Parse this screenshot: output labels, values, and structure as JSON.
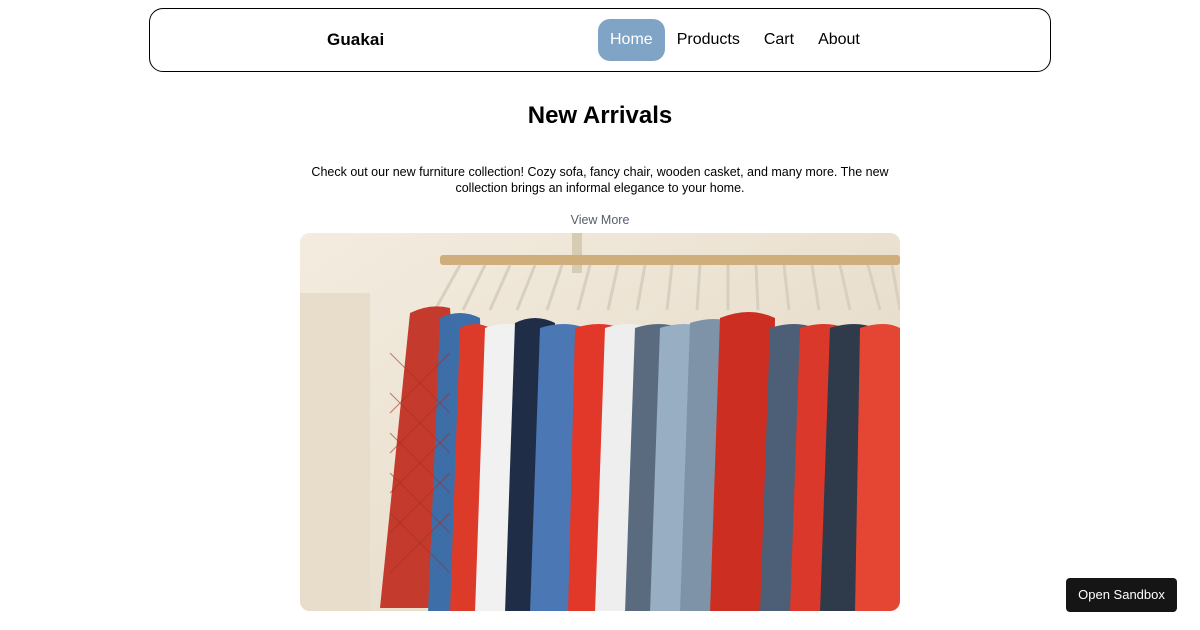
{
  "nav": {
    "brand": "Guakai",
    "links": [
      {
        "label": "Home",
        "active": true
      },
      {
        "label": "Products",
        "active": false
      },
      {
        "label": "Cart",
        "active": false
      },
      {
        "label": "About",
        "active": false
      }
    ],
    "active_color": "#7fa4c6"
  },
  "main": {
    "title": "New Arrivals",
    "description": "Check out our new furniture collection! Cozy sofa, fancy chair, wooden casket, and many more. The new collection brings an informal elegance to your home.",
    "view_more": "View More"
  },
  "hero_image": {
    "subject": "clothes rack with shirts and jackets on hangers",
    "colors": [
      "#d0392b",
      "#3f6fa8",
      "#f2f2f2",
      "#8da7bd",
      "#374151"
    ]
  },
  "sandbox": {
    "label": "Open Sandbox"
  }
}
